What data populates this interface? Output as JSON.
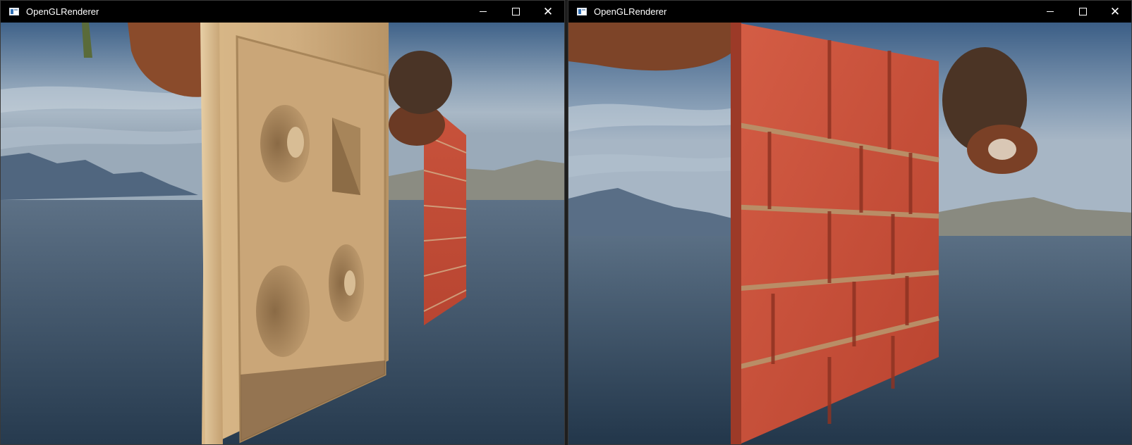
{
  "windows": [
    {
      "title": "OpenGLRenderer",
      "controls": {
        "minimize": "minimize-icon",
        "maximize": "maximize-icon",
        "close": "close-icon"
      },
      "scene": "wood-parallax-panel"
    },
    {
      "title": "OpenGLRenderer",
      "controls": {
        "minimize": "minimize-icon",
        "maximize": "maximize-icon",
        "close": "close-icon"
      },
      "scene": "brick-parallax-wall"
    }
  ],
  "colors": {
    "sky_top": "#3d5f86",
    "sky_mid": "#8fa4bb",
    "water": "#34495d",
    "wood": "#cfa877",
    "brick": "#c8513a",
    "mortar": "#b08a66"
  }
}
